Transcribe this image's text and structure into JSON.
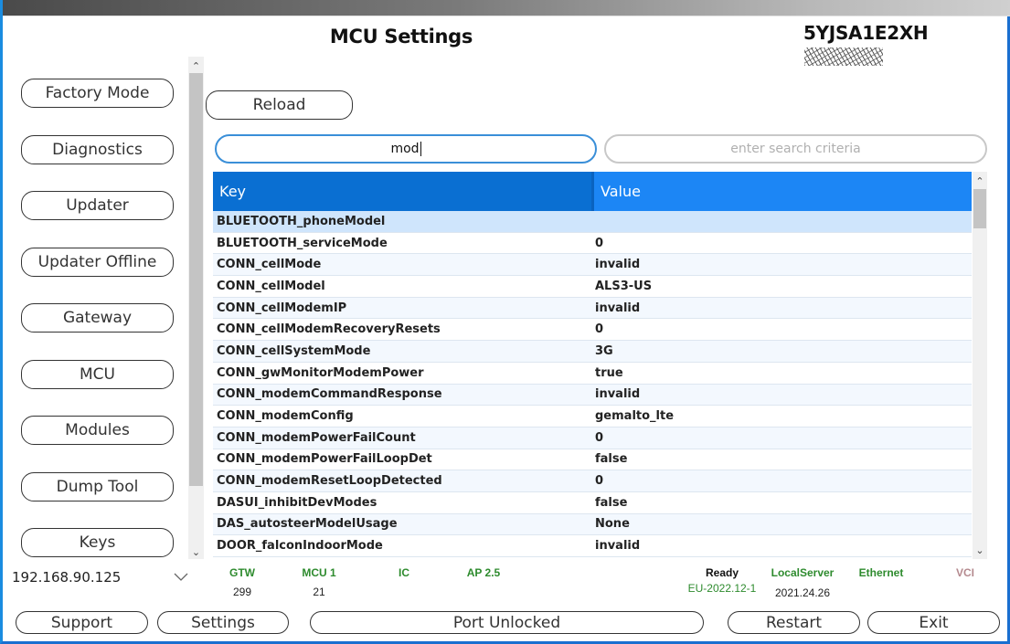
{
  "window": {
    "title": "MCU Settings",
    "vin_visible": "5YJSA1E2XH",
    "vin_masked": true
  },
  "sidebar": {
    "items": [
      {
        "label": "Factory Mode"
      },
      {
        "label": "Diagnostics"
      },
      {
        "label": "Updater"
      },
      {
        "label": "Updater Offline"
      },
      {
        "label": "Gateway"
      },
      {
        "label": "MCU"
      },
      {
        "label": "Modules"
      },
      {
        "label": "Dump Tool"
      },
      {
        "label": "Keys"
      }
    ],
    "ip_select": {
      "value": "192.168.90.125"
    }
  },
  "toolbar": {
    "reload_label": "Reload"
  },
  "search": {
    "key_filter_value": "mod",
    "criteria_placeholder": "enter search criteria"
  },
  "table": {
    "columns": [
      "Key",
      "Value"
    ],
    "selected_index": 0,
    "rows": [
      {
        "key": "BLUETOOTH_phoneModel",
        "value": ""
      },
      {
        "key": "BLUETOOTH_serviceMode",
        "value": "0"
      },
      {
        "key": "CONN_cellMode",
        "value": "invalid"
      },
      {
        "key": "CONN_cellModel",
        "value": "ALS3-US"
      },
      {
        "key": "CONN_cellModemIP",
        "value": "invalid"
      },
      {
        "key": "CONN_cellModemRecoveryResets",
        "value": "0"
      },
      {
        "key": "CONN_cellSystemMode",
        "value": "3G"
      },
      {
        "key": "CONN_gwMonitorModemPower",
        "value": "true"
      },
      {
        "key": "CONN_modemCommandResponse",
        "value": "invalid"
      },
      {
        "key": "CONN_modemConfig",
        "value": "gemalto_lte"
      },
      {
        "key": "CONN_modemPowerFailCount",
        "value": "0"
      },
      {
        "key": "CONN_modemPowerFailLoopDet",
        "value": "false"
      },
      {
        "key": "CONN_modemResetLoopDetected",
        "value": "0"
      },
      {
        "key": "DASUI_inhibitDevModes",
        "value": "false"
      },
      {
        "key": "DAS_autosteerModelUsage",
        "value": "None"
      },
      {
        "key": "DOOR_falconIndoorMode",
        "value": "invalid"
      }
    ]
  },
  "status": {
    "gtw": {
      "label": "GTW",
      "value": "299"
    },
    "mcu": {
      "label": "MCU 1",
      "value": "21"
    },
    "ic": {
      "label": "IC",
      "value": ""
    },
    "ap": {
      "label": "AP 2.5",
      "value": ""
    },
    "ready": {
      "label": "Ready",
      "value": "EU-2022.12-1"
    },
    "server": {
      "label": "LocalServer",
      "value": "2021.24.26"
    },
    "connection": {
      "label": "Ethernet"
    },
    "vci": {
      "label": "VCI"
    },
    "colors": {
      "ok": "#2e8b2e",
      "inactive": "#b58a8f",
      "accent": "#1c86f5"
    }
  },
  "bottom_bar": {
    "support_label": "Support",
    "settings_label": "Settings",
    "port_label": "Port Unlocked",
    "restart_label": "Restart",
    "exit_label": "Exit"
  }
}
